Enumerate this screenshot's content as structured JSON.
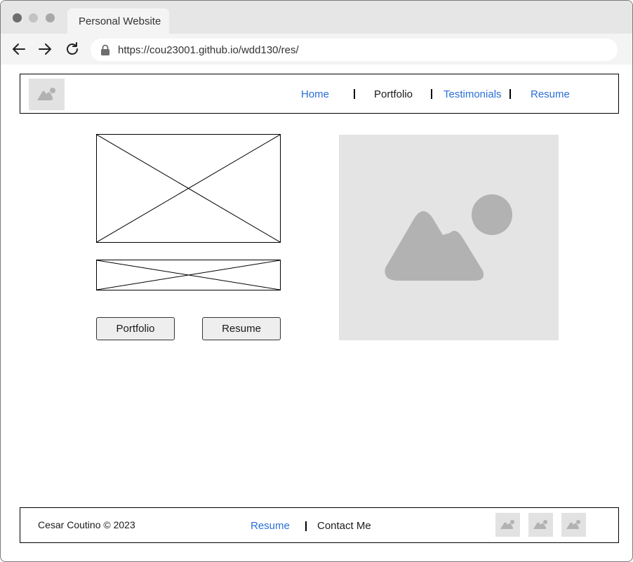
{
  "browser": {
    "tab_title": "Personal Website",
    "url": "https://cou23001.github.io/wdd130/res/"
  },
  "header": {
    "nav": [
      {
        "label": "Home",
        "color": "#2a6fd6"
      },
      {
        "label": "Portfolio",
        "color": "#1a1a1a"
      },
      {
        "label": "Testimonials",
        "color": "#2a6fd6"
      },
      {
        "label": "Resume",
        "color": "#2a6fd6"
      }
    ]
  },
  "hero": {
    "buttons": {
      "portfolio_label": "Portfolio",
      "resume_label": "Resume"
    }
  },
  "footer": {
    "copyright": "Cesar Coutino © 2023",
    "links": [
      {
        "label": "Resume",
        "color": "#2a6fd6"
      },
      {
        "label": "Contact Me",
        "color": "#1a1a1a"
      }
    ],
    "social_icons": [
      "image-icon",
      "image-icon",
      "image-icon"
    ]
  },
  "colors": {
    "link_blue": "#2a6fd6",
    "placeholder_gray": "#e4e4e4",
    "icon_gray": "#b2b2b2"
  }
}
